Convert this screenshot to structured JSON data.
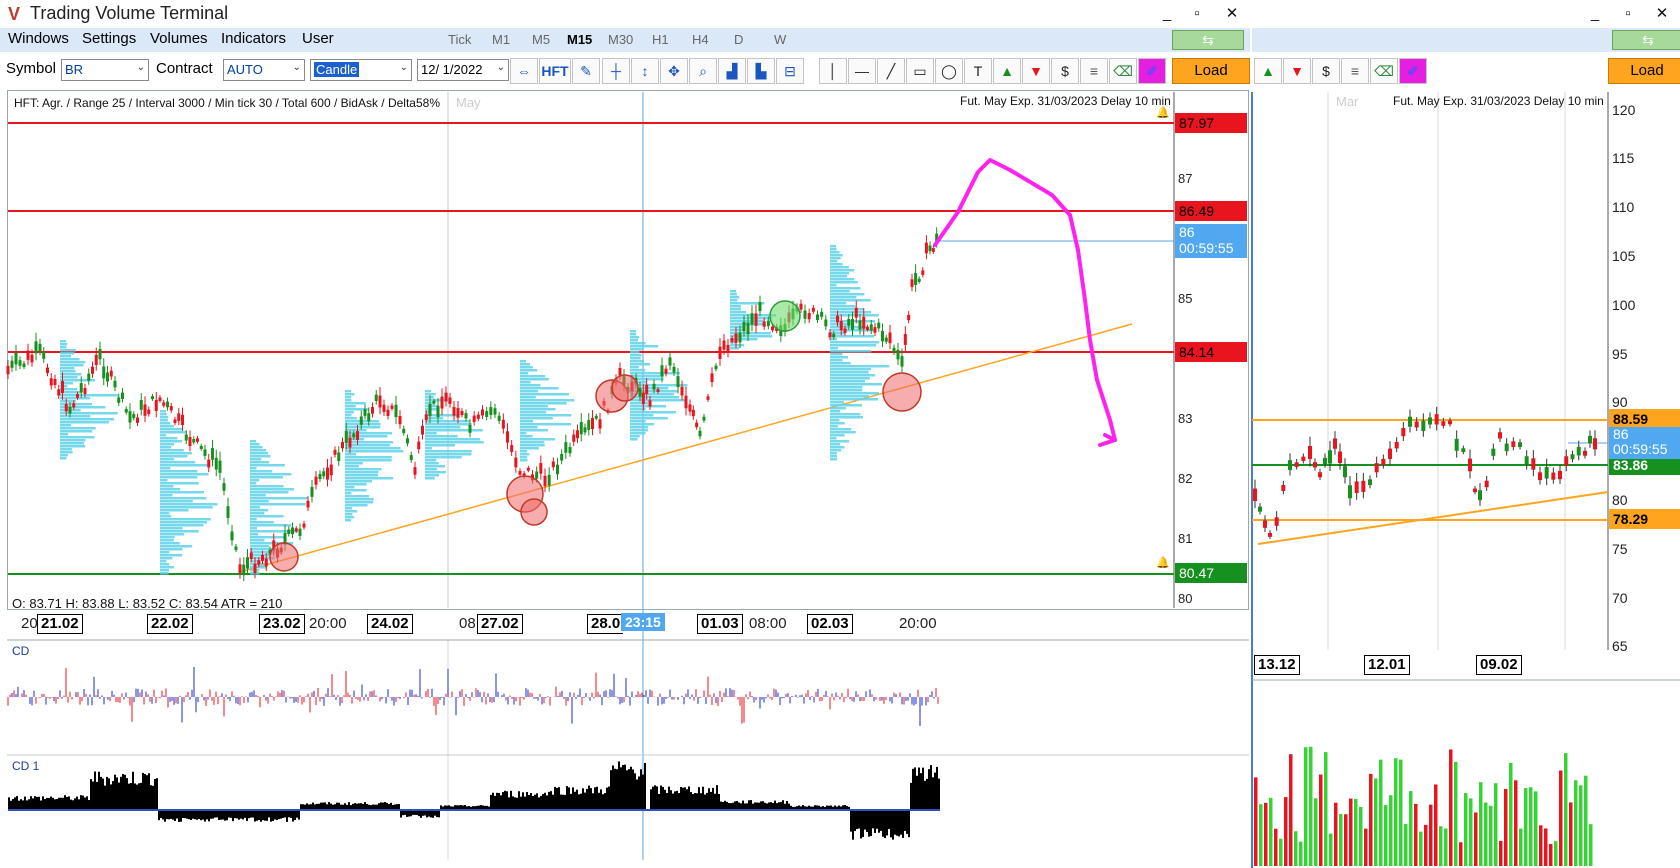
{
  "window": {
    "title": "Trading Volume Terminal",
    "controls": [
      "_",
      "▫",
      "✕"
    ],
    "right_controls": [
      "_",
      "▫",
      "✕"
    ]
  },
  "menu": {
    "items": [
      "Windows",
      "Settings",
      "Volumes",
      "Indicators",
      "User"
    ],
    "timeframes": [
      "Tick",
      "M1",
      "M5",
      "M15",
      "M30",
      "H1",
      "H4",
      "D",
      "W"
    ],
    "active_timeframe": "M15"
  },
  "toolbar": {
    "symbol_label": "Symbol",
    "symbol_value": "BR",
    "contract_label": "Contract",
    "contract_value": "AUTO",
    "chart_type_value": "Candle",
    "date_value": "12/  1/2022",
    "hft_label": "HFT",
    "load_label": "Load",
    "right_load_label": "Load"
  },
  "main_chart": {
    "info": "HFT: Agr. / Range 25 / Interval 3000 / Min tick 30 / Total 600 / BidAsk / Delta58%",
    "month_watermark": "May",
    "futures_info": "Fut. May Exp. 31/03/2023 Delay 10 min",
    "ohlc": "O: 83.71   H: 83.88   L: 83.52   C: 83.54   ATR = 210",
    "price_axis": [
      "87",
      "85",
      "83",
      "82",
      "81",
      "80"
    ],
    "level_labels": [
      {
        "text": "87.97",
        "color": "#e8141e"
      },
      {
        "text": "86.49",
        "color": "#e8141e"
      },
      {
        "text": "84.14",
        "color": "#e8141e"
      },
      {
        "text": "80.47",
        "color": "#16901e"
      }
    ],
    "current_price": "86",
    "timer": "00:59:55",
    "time_axis": [
      "20",
      "21.02",
      "22.02",
      "23.02",
      "20:00",
      "24.02",
      "08",
      "27.02",
      "28.0",
      "23:15",
      "01.03",
      "08:00",
      "02.03",
      "20:00"
    ]
  },
  "right_chart": {
    "month_watermark": "Mar",
    "futures_info": "Fut. May Exp. 31/03/2023 Delay 10 min",
    "price_axis": [
      "120",
      "115",
      "110",
      "105",
      "100",
      "95",
      "90",
      "80",
      "75",
      "70",
      "65"
    ],
    "level_labels": [
      {
        "text": "88.59",
        "color": "#ffa41e"
      },
      {
        "text": "83.86",
        "color": "#16901e"
      },
      {
        "text": "78.29",
        "color": "#ffa41e"
      }
    ],
    "current_price": "86",
    "timer": "00:59:55",
    "time_axis": [
      "13.12",
      "12.01",
      "09.02"
    ]
  },
  "panes": {
    "cd_label": "CD",
    "cd1_label": "CD 1"
  },
  "colors": {
    "accent": "#ffa41e",
    "volume_profile": "#5fd3e8",
    "bull": "#16901e",
    "bear": "#e8141e",
    "annotation": "#ff22ee"
  }
}
